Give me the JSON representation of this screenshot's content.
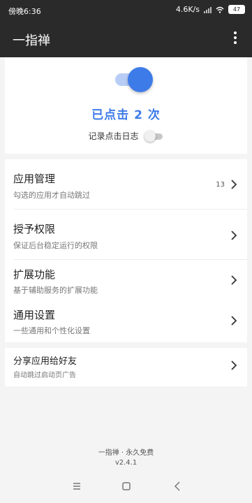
{
  "status": {
    "time": "傍晚6:36",
    "network_speed": "4.6K/s",
    "battery": "47",
    "icons": [
      "signal-icon",
      "wifi-icon",
      "battery-icon"
    ]
  },
  "app": {
    "title": "一指禅",
    "menu_icon": "more-vertical-icon"
  },
  "main": {
    "service_toggle_on": true,
    "click_count_text": "已点击 2 次",
    "log_label": "记录点击日志",
    "log_toggle_on": false
  },
  "menu": {
    "items": [
      {
        "title": "应用管理",
        "subtitle": "勾选的应用才自动跳过",
        "count": "13"
      },
      {
        "title": "授予权限",
        "subtitle": "保证后台稳定运行的权限"
      },
      {
        "title": "扩展功能",
        "subtitle": "基于辅助服务的扩展功能"
      },
      {
        "title": "通用设置",
        "subtitle": "一些通用和个性化设置"
      }
    ]
  },
  "share": {
    "title": "分享应用给好友",
    "subtitle": "自动跳过启动页广告"
  },
  "footer": {
    "line1": "一指禅 · 永久免费",
    "version": "v2.4.1"
  },
  "colors": {
    "accent": "#3d7be8",
    "appbar": "#2a2a2a",
    "background": "#f4f4f4"
  }
}
